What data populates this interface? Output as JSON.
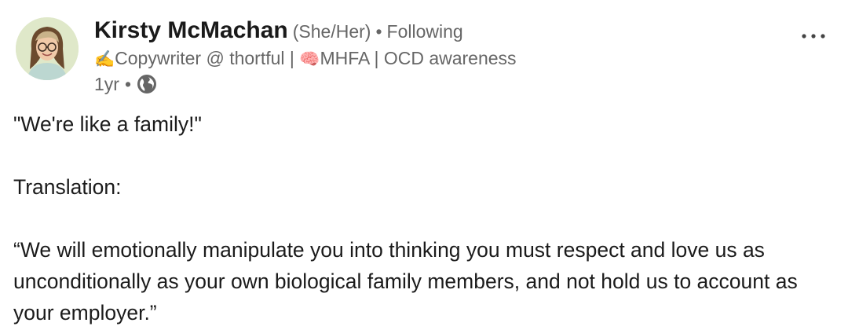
{
  "author": {
    "name": "Kirsty McMachan",
    "pronouns": "(She/Her)",
    "separator": "•",
    "follow_status": "Following",
    "headline_part1": "Copywriter @ thortful | ",
    "headline_part2": "MHFA | OCD awareness",
    "headline_emoji_1": "✍️",
    "headline_emoji_2": "🧠",
    "avatar_icon": "profile-photo"
  },
  "meta": {
    "time": "1yr",
    "separator": "•",
    "visibility_icon": "globe-icon"
  },
  "menu": {
    "icon": "more-options-icon"
  },
  "post": {
    "line1": "\"We're like a family!\"",
    "line2": "Translation:",
    "line3": "“We will emotionally manipulate you into thinking you must respect and love us as unconditionally as your own biological family members, and not hold us to account as your employer.”"
  },
  "colors": {
    "text_primary": "#1a1a1a",
    "text_secondary": "#666666",
    "avatar_bg": "#dfe8c9"
  }
}
